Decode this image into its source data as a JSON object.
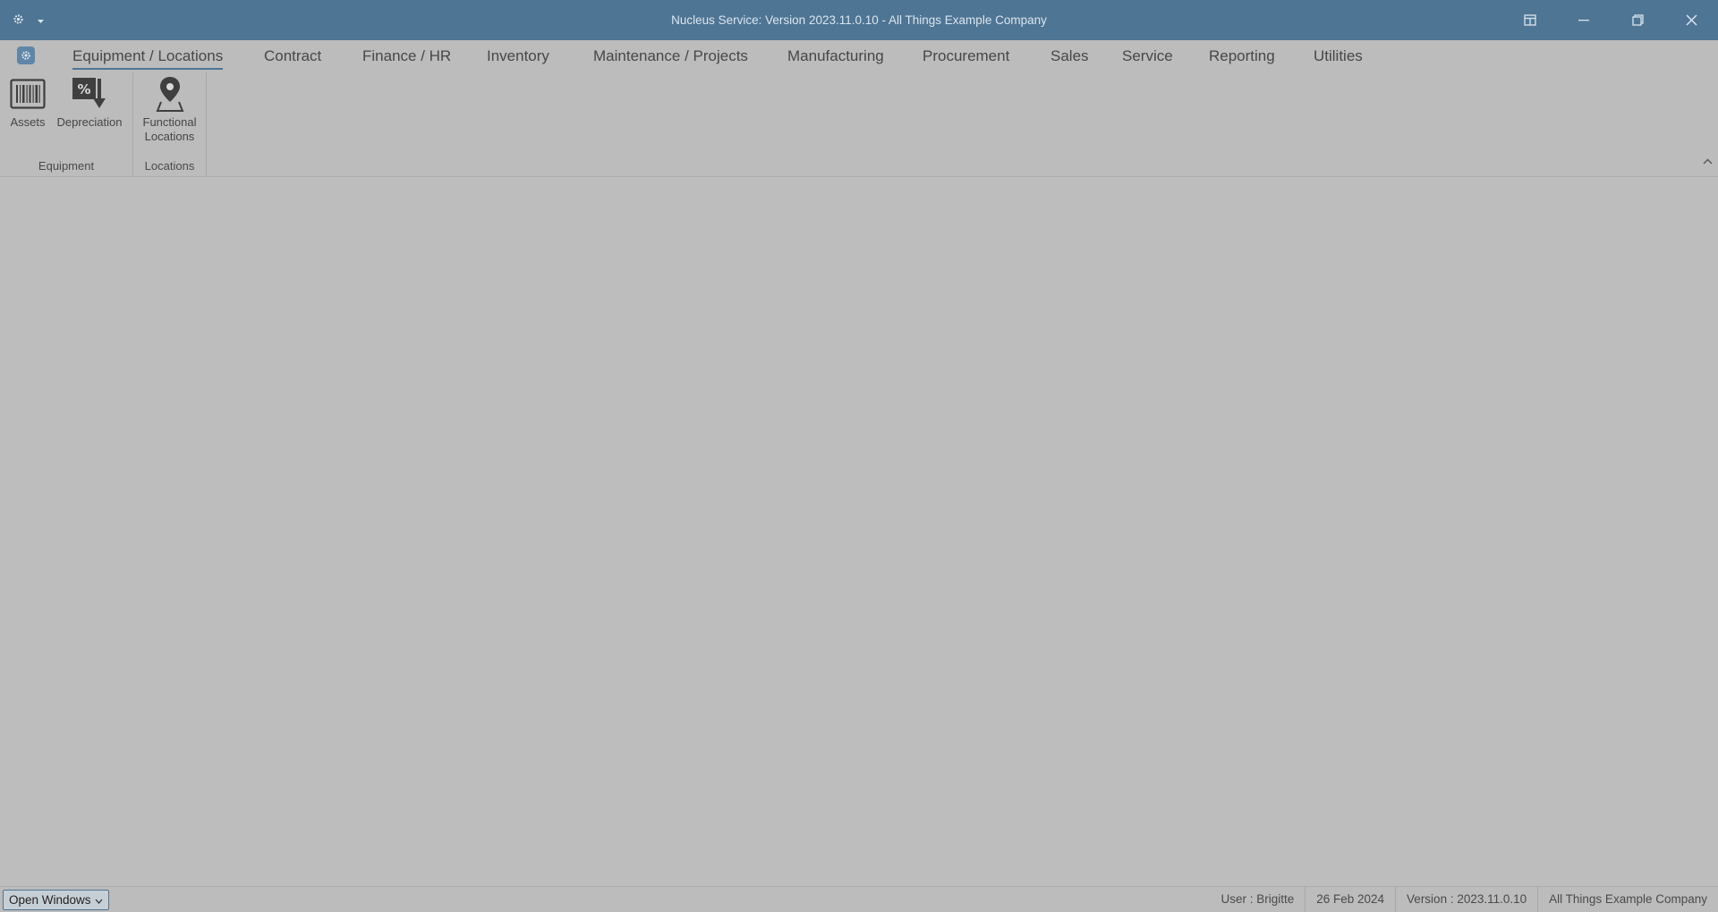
{
  "window": {
    "title": "Nucleus Service: Version 2023.11.0.10 - All Things Example Company"
  },
  "quick_access": {
    "icon": "gear-icon",
    "dropdown_icon": "chevron-down-icon"
  },
  "window_controls": [
    "layout-icon",
    "minimize-icon",
    "restore-icon",
    "close-icon"
  ],
  "tabs": [
    {
      "label": "Equipment / Locations",
      "active": true
    },
    {
      "label": "Contract"
    },
    {
      "label": "Finance / HR"
    },
    {
      "label": "Inventory"
    },
    {
      "label": "Maintenance / Projects"
    },
    {
      "label": "Manufacturing"
    },
    {
      "label": "Procurement"
    },
    {
      "label": "Sales"
    },
    {
      "label": "Service"
    },
    {
      "label": "Reporting"
    },
    {
      "label": "Utilities"
    }
  ],
  "ribbon": {
    "groups": [
      {
        "label": "Equipment",
        "buttons": [
          {
            "label": "Assets",
            "icon": "barcode-icon"
          },
          {
            "label": "Depreciation",
            "icon": "depreciation-icon"
          }
        ]
      },
      {
        "label": "Locations",
        "buttons": [
          {
            "label": "Functional\nLocations",
            "icon": "location-pin-icon"
          }
        ]
      }
    ]
  },
  "statusbar": {
    "open_windows": "Open Windows",
    "user": "User : Brigitte",
    "date": "26 Feb 2024",
    "version": "Version : 2023.11.0.10",
    "company": "All Things Example Company"
  },
  "colors": {
    "titlebar": "#4e7594",
    "background": "#bdbdbd",
    "accent": "#4e7594"
  }
}
